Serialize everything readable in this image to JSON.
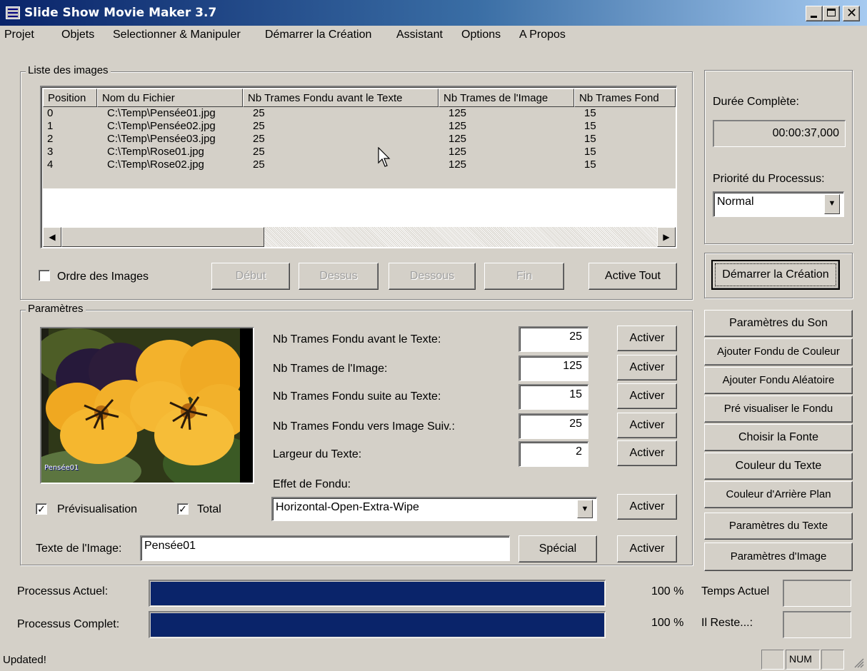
{
  "window": {
    "title": "Slide Show Movie Maker 3.7"
  },
  "menu": [
    "Projet",
    "Objets",
    "Selectionner & Manipuler",
    "Démarrer la Création",
    "Assistant",
    "Options",
    "A Propos"
  ],
  "image_list": {
    "legend": "Liste des images",
    "columns": [
      "Position",
      "Nom du Fichier",
      "Nb Trames Fondu avant le Texte",
      "Nb Trames de l'Image",
      "Nb Trames Fond"
    ],
    "rows": [
      [
        "0",
        "C:\\Temp\\Pensée01.jpg",
        "25",
        "125",
        "15"
      ],
      [
        "1",
        "C:\\Temp\\Pensée02.jpg",
        "25",
        "125",
        "15"
      ],
      [
        "2",
        "C:\\Temp\\Pensée03.jpg",
        "25",
        "125",
        "15"
      ],
      [
        "3",
        "C:\\Temp\\Rose01.jpg",
        "25",
        "125",
        "15"
      ],
      [
        "4",
        "C:\\Temp\\Rose02.jpg",
        "25",
        "125",
        "15"
      ]
    ],
    "order_checkbox_label": "Ordre des Images",
    "order_checked": false,
    "buttons": {
      "debut": "Début",
      "dessus": "Dessus",
      "dessous": "Dessous",
      "fin": "Fin",
      "active_tout": "Active Tout"
    }
  },
  "duration": {
    "label": "Durée Complète:",
    "value": "00:00:37,000",
    "priority_label": "Priorité du Processus:",
    "priority_value": "Normal"
  },
  "start_button": "Démarrer la Création",
  "side_buttons": [
    "Paramètres du Son",
    "Ajouter Fondu de Couleur",
    "Ajouter Fondu Aléatoire",
    "Pré visualiser le Fondu",
    "Choisir la Fonte",
    "Couleur du Texte",
    "Couleur d'Arrière Plan",
    "Paramètres du Texte",
    "Paramètres d'Image"
  ],
  "parameters": {
    "legend": "Paramètres",
    "preview_caption": "Pensée01",
    "fields": [
      {
        "label": "Nb Trames Fondu avant le Texte:",
        "value": "25"
      },
      {
        "label": "Nb Trames de l'Image:",
        "value": "125"
      },
      {
        "label": "Nb Trames Fondu suite au Texte:",
        "value": "15"
      },
      {
        "label": "Nb Trames Fondu vers Image Suiv.:",
        "value": "25"
      },
      {
        "label": "Largeur du Texte:",
        "value": "2"
      }
    ],
    "activate_label": "Activer",
    "effect_label": "Effet de Fondu:",
    "effect_value": "Horizontal-Open-Extra-Wipe",
    "preview_checkbox": "Prévisualisation",
    "preview_checked": true,
    "total_checkbox": "Total",
    "total_checked": true,
    "image_text_label": "Texte de l'Image:",
    "image_text_value": "Pensée01",
    "special_button": "Spécial"
  },
  "progress": {
    "current_label": "Processus Actuel:",
    "current_percent_text": "100 %",
    "current_fraction": 1.0,
    "complete_label": "Processus Complet:",
    "complete_percent_text": "100 %",
    "complete_fraction": 1.0,
    "time_current_label": "Temps Actuel",
    "time_remaining_label": "Il Reste...:"
  },
  "status": {
    "text": "Updated!",
    "num": "NUM"
  },
  "colors": {
    "face": "#d4d0c8",
    "title_start": "#0a246a",
    "progress_fill": "#0a246a"
  }
}
